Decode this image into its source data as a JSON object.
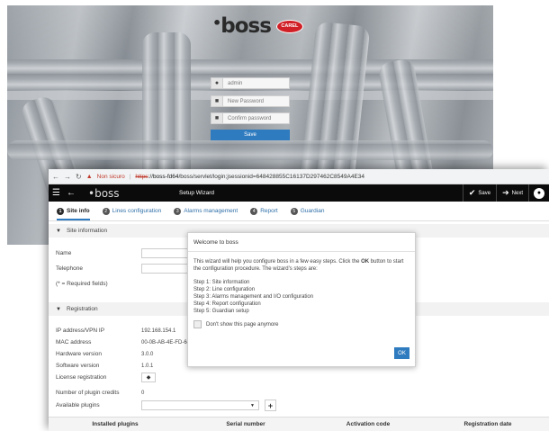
{
  "login": {
    "brand": "boss",
    "brand_badge": "CAREL",
    "username": "admin",
    "new_password_placeholder": "New Password",
    "confirm_password_placeholder": "Confirm password",
    "save_label": "Save"
  },
  "browser": {
    "not_secure": "Non sicuro",
    "url_scheme": "https",
    "url_host": "boss-fd64",
    "url_path": "/boss/servlet/login;jsessionid=648428855C16137D297462C8549A4E34"
  },
  "appbar": {
    "logo": "boss",
    "title": "Setup Wizard",
    "save_label": "Save",
    "next_label": "Next"
  },
  "tabs": [
    {
      "num": "1",
      "label": "Site info"
    },
    {
      "num": "2",
      "label": "Lines configuration"
    },
    {
      "num": "3",
      "label": "Alarms management"
    },
    {
      "num": "4",
      "label": "Report"
    },
    {
      "num": "5",
      "label": "Guardian"
    }
  ],
  "site_info": {
    "section_title": "Site information",
    "name_label": "Name",
    "telephone_label": "Telephone",
    "required_note": "(* = Required fields)"
  },
  "registration": {
    "section_title": "Registration",
    "rows": [
      {
        "label": "IP address/VPN IP",
        "value": "192.168.154.1"
      },
      {
        "label": "MAC address",
        "value": "00-0B-AB-4E-FD-64"
      },
      {
        "label": "Hardware version",
        "value": "3.0.0"
      },
      {
        "label": "Software version",
        "value": "1.0.1"
      },
      {
        "label": "License registration",
        "value": ""
      },
      {
        "label": "Number of plugin credits",
        "value": "0"
      },
      {
        "label": "Available plugins",
        "value": ""
      }
    ]
  },
  "plugins_table": {
    "columns": [
      "Installed plugins",
      "Serial number",
      "Activation code",
      "Registration date"
    ]
  },
  "modal": {
    "title": "Welcome to boss",
    "intro_before": "This wizard will help you configure boss in a few easy steps. Click the ",
    "intro_bold": "OK",
    "intro_after": " button to start the configuration procedure. The wizard's steps are:",
    "steps": [
      "Step 1: Site information",
      "Step 2: Line configuration",
      "Step 3: Alarms management and I/O configuration",
      "Step 4: Report configuration",
      "Step 5: Guardian setup"
    ],
    "dont_show": "Don't show this page anymore",
    "ok_label": "OK"
  },
  "colors": {
    "accent": "#2f7bbf",
    "appbar": "#0b0b0b",
    "brand_red": "#d01f26",
    "warning": "#c0392b"
  }
}
